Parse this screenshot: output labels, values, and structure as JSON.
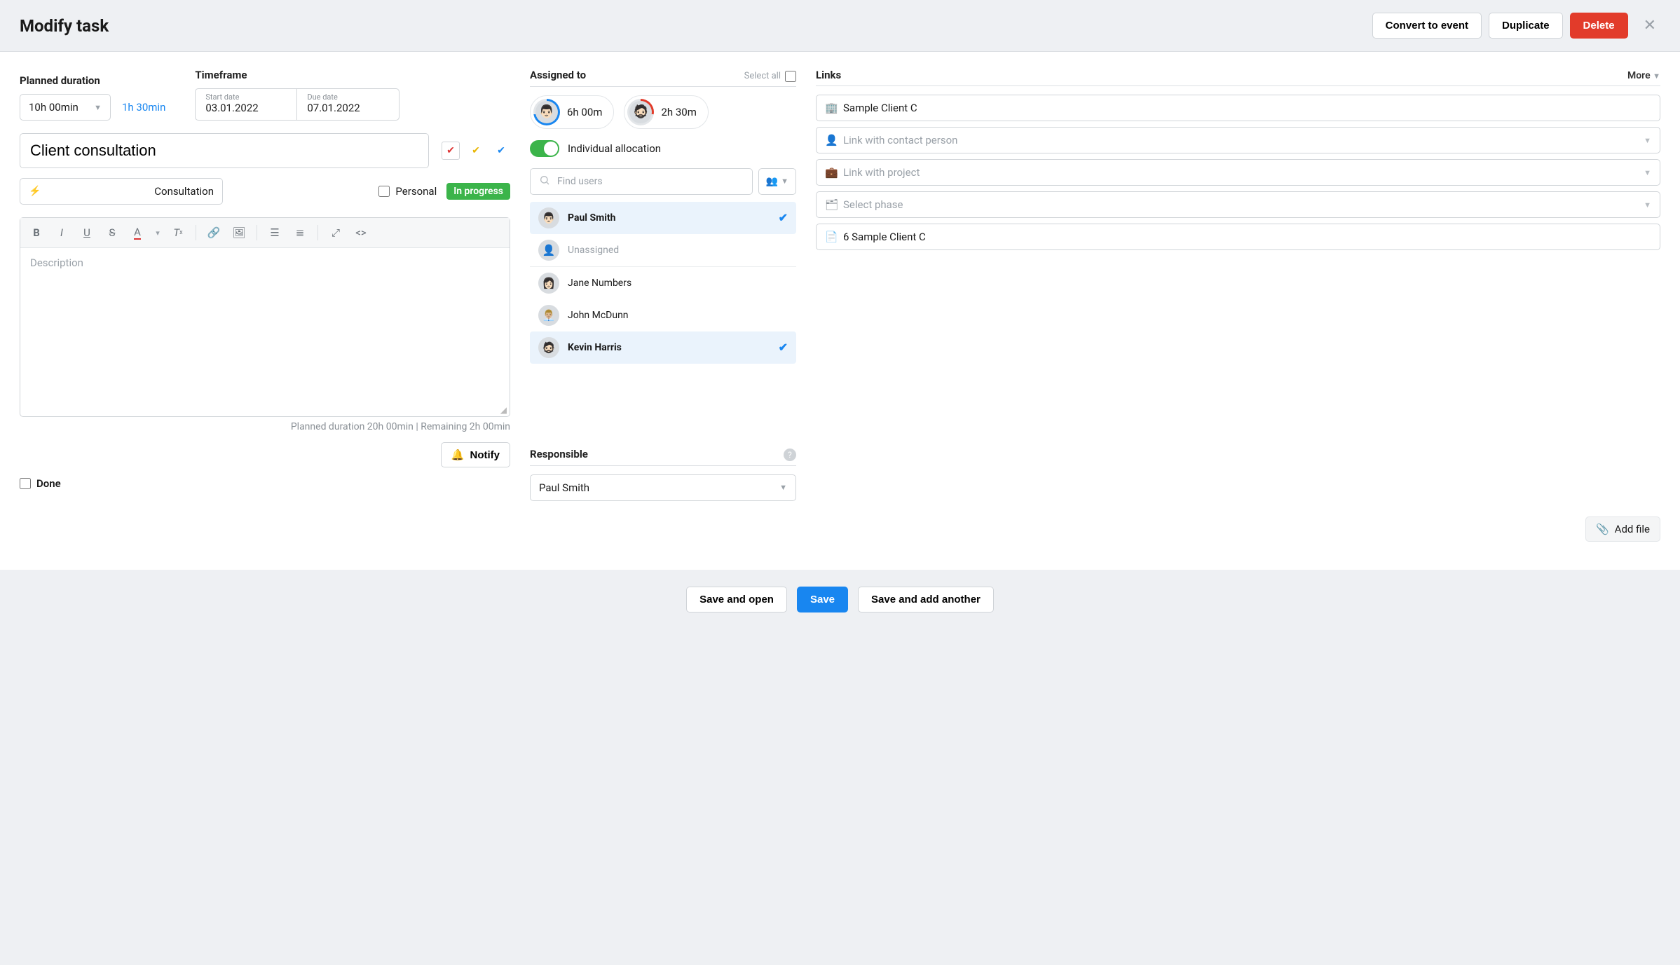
{
  "header": {
    "title": "Modify task",
    "actions": {
      "convert": "Convert to event",
      "duplicate": "Duplicate",
      "delete": "Delete"
    }
  },
  "left": {
    "planned_duration_label": "Planned duration",
    "planned_duration_value": "10h 00min",
    "elapsed": "1h 30min",
    "timeframe_label": "Timeframe",
    "start_date_label": "Start date",
    "start_date_value": "03.01.2022",
    "due_date_label": "Due date",
    "due_date_value": "07.01.2022",
    "task_title": "Client consultation",
    "tag_value": "Consultation",
    "personal_label": "Personal",
    "status": "In progress",
    "description_placeholder": "Description",
    "duration_note": "Planned duration 20h 00min | Remaining 2h 00min",
    "notify_label": "Notify",
    "done_label": "Done"
  },
  "assigned": {
    "label": "Assigned to",
    "select_all": "Select all",
    "chips": [
      {
        "time": "6h 00m",
        "ring": "blue",
        "face": "👨🏻"
      },
      {
        "time": "2h 30m",
        "ring": "red",
        "face": "🧔🏻"
      }
    ],
    "individual_label": "Individual allocation",
    "search_placeholder": "Find users",
    "users": [
      {
        "name": "Paul Smith",
        "selected": true,
        "face": "👨🏻"
      },
      {
        "name": "Unassigned",
        "selected": false,
        "muted": true,
        "face": ""
      },
      {
        "name": "Jane Numbers",
        "selected": false,
        "face": "👩🏻"
      },
      {
        "name": "John McDunn",
        "selected": false,
        "face": "👨🏼‍💼"
      },
      {
        "name": "Kevin Harris",
        "selected": true,
        "face": "🧔🏻"
      }
    ],
    "responsible_label": "Responsible",
    "responsible_value": "Paul Smith"
  },
  "links": {
    "label": "Links",
    "more": "More",
    "client": "Sample Client C",
    "contact_placeholder": "Link with contact person",
    "project_placeholder": "Link with project",
    "phase_placeholder": "Select phase",
    "quote": "6 Sample Client C",
    "add_file": "Add file"
  },
  "footer": {
    "save_open": "Save and open",
    "save": "Save",
    "save_another": "Save and add another"
  }
}
